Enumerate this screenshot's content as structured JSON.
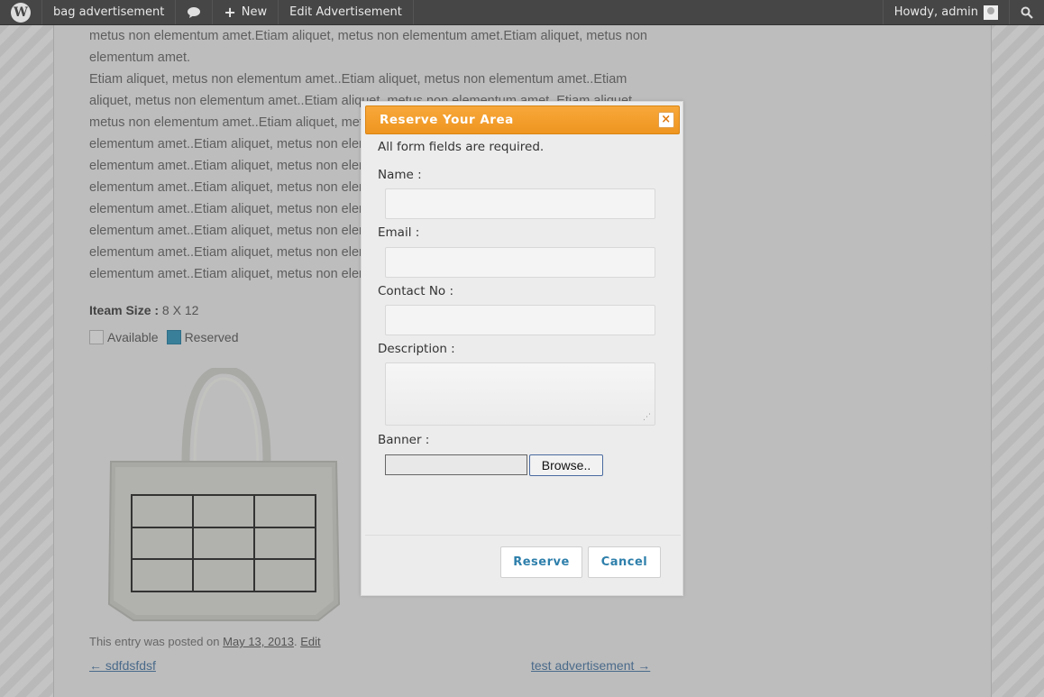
{
  "adminbar": {
    "site_name": "bag advertisement",
    "new_label": "New",
    "edit_label": "Edit Advertisement",
    "greeting": "Howdy, admin"
  },
  "content": {
    "paragraphs_visible": [
      "metus non elementum amet.Etiam aliquet, metus non elementum amet.Etiam aliquet, metus non",
      "elementum amet.",
      "Etiam aliquet, metus non elementum amet..Etiam aliquet, metus non elementum amet..Etiam",
      "aliquet, metus non elementum amet..Etiam aliquet, metus non elementum amet..Etiam aliquet,",
      "metus non elementum amet..Etiam aliquet, metus non elementum amet..Etiam aliquet, metus non",
      "elementum amet..Etiam aliquet, metus non elementum amet..Etiam aliquet, metus non",
      "elementum amet..Etiam aliquet, metus non elementum amet..Etiam aliquet, metus non",
      "elementum amet..Etiam aliquet, metus non elementum amet..Etiam aliquet, metus non",
      "elementum amet..Etiam aliquet, metus non elementum amet..Etiam aliquet, metus non",
      "elementum amet..Etiam aliquet, metus non elementum amet..Etiam aliquet, metus non",
      "elementum amet..Etiam aliquet, metus non elementum amet..Etiam aliquet, metus non",
      "elementum amet..Etiam aliquet, metus non elementum amet..Etiam aliquet, metus non"
    ],
    "item_size_label": "Iteam Size :",
    "item_size_value": "8 X 12",
    "legend_available": "Available",
    "legend_reserved": "Reserved",
    "reserved_color": "#3a7f9a",
    "posted_prefix": "This entry was posted on",
    "posted_date": "May 13, 2013",
    "posted_sep": ".",
    "edit_link": "Edit",
    "nav_prev": "← sdfdsfdsf",
    "nav_next": "test advertisement →"
  },
  "modal": {
    "title": "Reserve Your Area",
    "close_symbol": "×",
    "required_note": "All form fields are required.",
    "name_label": "Name :",
    "name_value": "",
    "email_label": "Email :",
    "email_value": "",
    "contact_label": "Contact No :",
    "contact_value": "",
    "description_label": "Description :",
    "description_value": "",
    "banner_label": "Banner :",
    "browse_label": "Browse..",
    "reserve_label": "Reserve",
    "cancel_label": "Cancel",
    "accent_color": "#f7a83a"
  }
}
